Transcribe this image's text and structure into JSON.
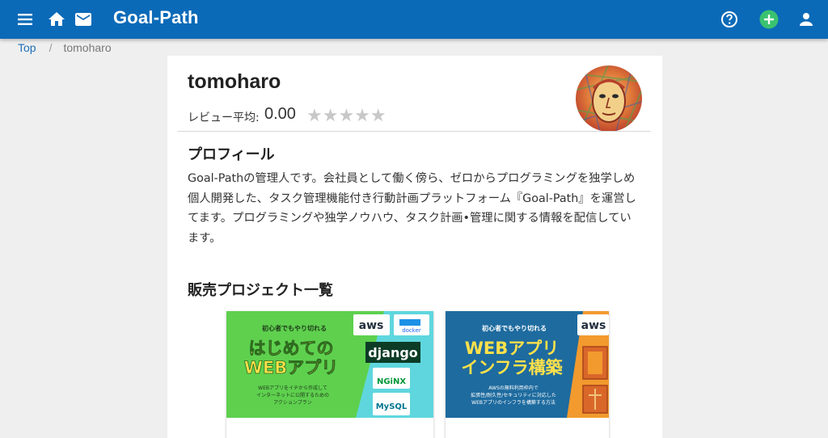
{
  "header": {
    "title": "Goal-Path",
    "colors": {
      "bar": "#0b6ab8",
      "add": "#3ac270"
    },
    "icons": [
      "menu-icon",
      "home-icon",
      "mail-icon",
      "help-icon",
      "add-icon",
      "account-icon"
    ]
  },
  "breadcrumb": {
    "top": "Top",
    "separator": "/",
    "current": "tomoharo"
  },
  "profile": {
    "username": "tomoharo",
    "review_label": "レビュー平均:",
    "review_value": "0.00",
    "rating": 0,
    "stars": "★★★★★",
    "section_title": "プロフィール",
    "text": "Goal-Pathの管理人です。会社員として働く傍ら、ゼロからプログラミングを独学しめ個人開発した、タスク管理機能付き行動計画プラットフォーム『Goal-Path』を運営してます。プログラミングや独学ノウハウ、タスク計画•管理に関する情報を配信しています。"
  },
  "projects": {
    "title": "販売プロジェクト一覧",
    "items": [
      {
        "tagline": "初心者でもやり切れる",
        "line1": "はじめての",
        "line2": "WEBアプリ",
        "desc1": "WEBアプリをイチから作成して",
        "desc2": "インターネットに公開するための",
        "desc3": "アクションプラン",
        "logo_aws": "aws",
        "logo_docker": "docker",
        "logo_django": "django",
        "logo_nginx": "NGiNX",
        "logo_mysql": "MySQL",
        "color": "#5ed04e"
      },
      {
        "tagline": "初心者でもやり切れる",
        "line1": "WEBアプリ",
        "line2": "インフラ構築",
        "desc1": "AWSの無料利用枠内で",
        "desc2": "拡張性/耐久性/セキュリティに対応した",
        "desc3": "WEBアプリのインフラを構築する方法",
        "logo_aws": "aws",
        "color": "#1e6b9f"
      }
    ]
  }
}
